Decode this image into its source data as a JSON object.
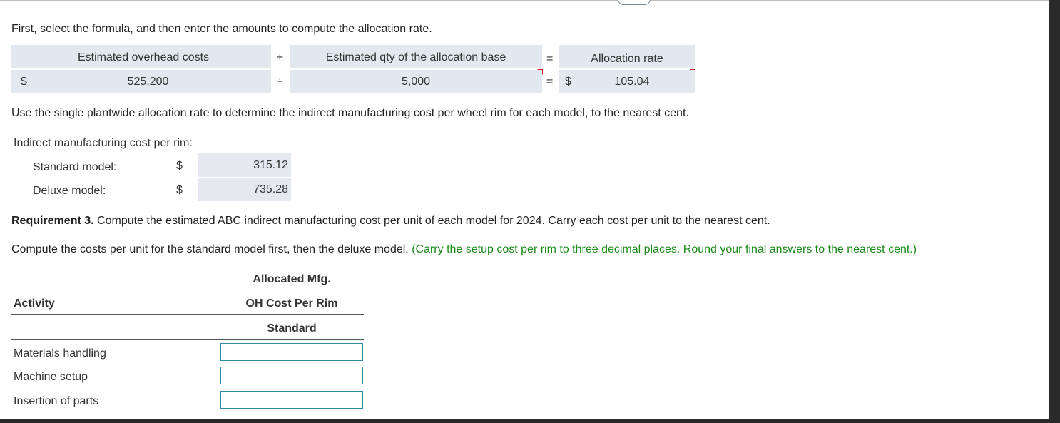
{
  "instructions": {
    "formula_prompt": "First, select the formula, and then enter the amounts to compute the allocation rate.",
    "plantwide_prompt": "Use the single plantwide allocation rate to determine the indirect manufacturing cost per wheel rim for each model, to the nearest cent.",
    "req3_label": "Requirement 3.",
    "req3_text": " Compute the estimated ABC indirect manufacturing cost per unit of each model for 2024. Carry each cost per unit to the nearest cent.",
    "compute_text": "Compute the costs per unit for the standard model first, then the deluxe model.",
    "compute_hint": " (Carry the setup cost per rim to three decimal places. Round your final answers to the nearest cent.)"
  },
  "formula": {
    "numerator_label": "Estimated overhead costs",
    "divide_sign": "÷",
    "denominator_label": "Estimated qty of the allocation base",
    "equals_sign": "=",
    "result_label": "Allocation rate",
    "currency": "$",
    "numerator_value": "525,200",
    "denominator_value": "5,000",
    "result_value": "105.04"
  },
  "indirect_cost": {
    "heading": "Indirect manufacturing cost per rim:",
    "rows": [
      {
        "label": "Standard model:",
        "currency": "$",
        "value": "315.12"
      },
      {
        "label": "Deluxe model:",
        "currency": "$",
        "value": "735.28"
      }
    ]
  },
  "abc_table": {
    "header_line1": "Allocated Mfg.",
    "header_line2": "OH Cost Per Rim",
    "activity_header": "Activity",
    "subheader": "Standard",
    "rows": [
      {
        "label": "Materials handling",
        "value": ""
      },
      {
        "label": "Machine setup",
        "value": ""
      },
      {
        "label": "Insertion of parts",
        "value": ""
      }
    ]
  },
  "colors": {
    "cell_shade": "#e3e8f0",
    "input_border": "#2d8fa3",
    "hint_green": "#1a8a1a",
    "error_marker": "#cc1f1f"
  }
}
